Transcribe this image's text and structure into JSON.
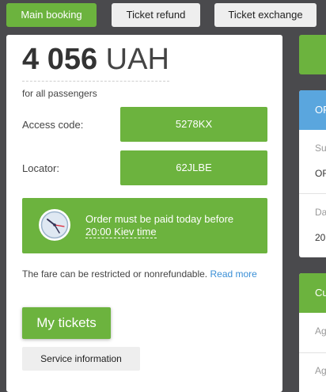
{
  "tabs": {
    "main_booking": "Main booking",
    "ticket_refund": "Ticket refund",
    "ticket_exchange": "Ticket exchange"
  },
  "booking": {
    "price_amount": "4 056",
    "price_currency": "UAH",
    "price_note": "for all passengers",
    "access_code_label": "Access code:",
    "access_code": "5278KX",
    "locator_label": "Locator:",
    "locator": "62JLBE",
    "notice_prefix": "Order must be paid today before ",
    "notice_deadline": "20:00 Kiev time",
    "fare_text": "The fare can be restricted or nonrefundable. ",
    "fare_link": "Read more",
    "my_tickets": "My tickets",
    "service_info": "Service information"
  },
  "right_panel": {
    "card1_head": "OR",
    "card1_label1": "Su",
    "card1_value1": "OR",
    "card1_label2": "Da",
    "card1_value2": "20",
    "card2_head": "Cu",
    "card2_label1": "Ag",
    "card2_label2": "Ag"
  },
  "colors": {
    "accent_green": "#6cb33e",
    "accent_blue": "#5aa6de",
    "link_blue": "#3a8fd6",
    "background": "#4a4a4d"
  }
}
